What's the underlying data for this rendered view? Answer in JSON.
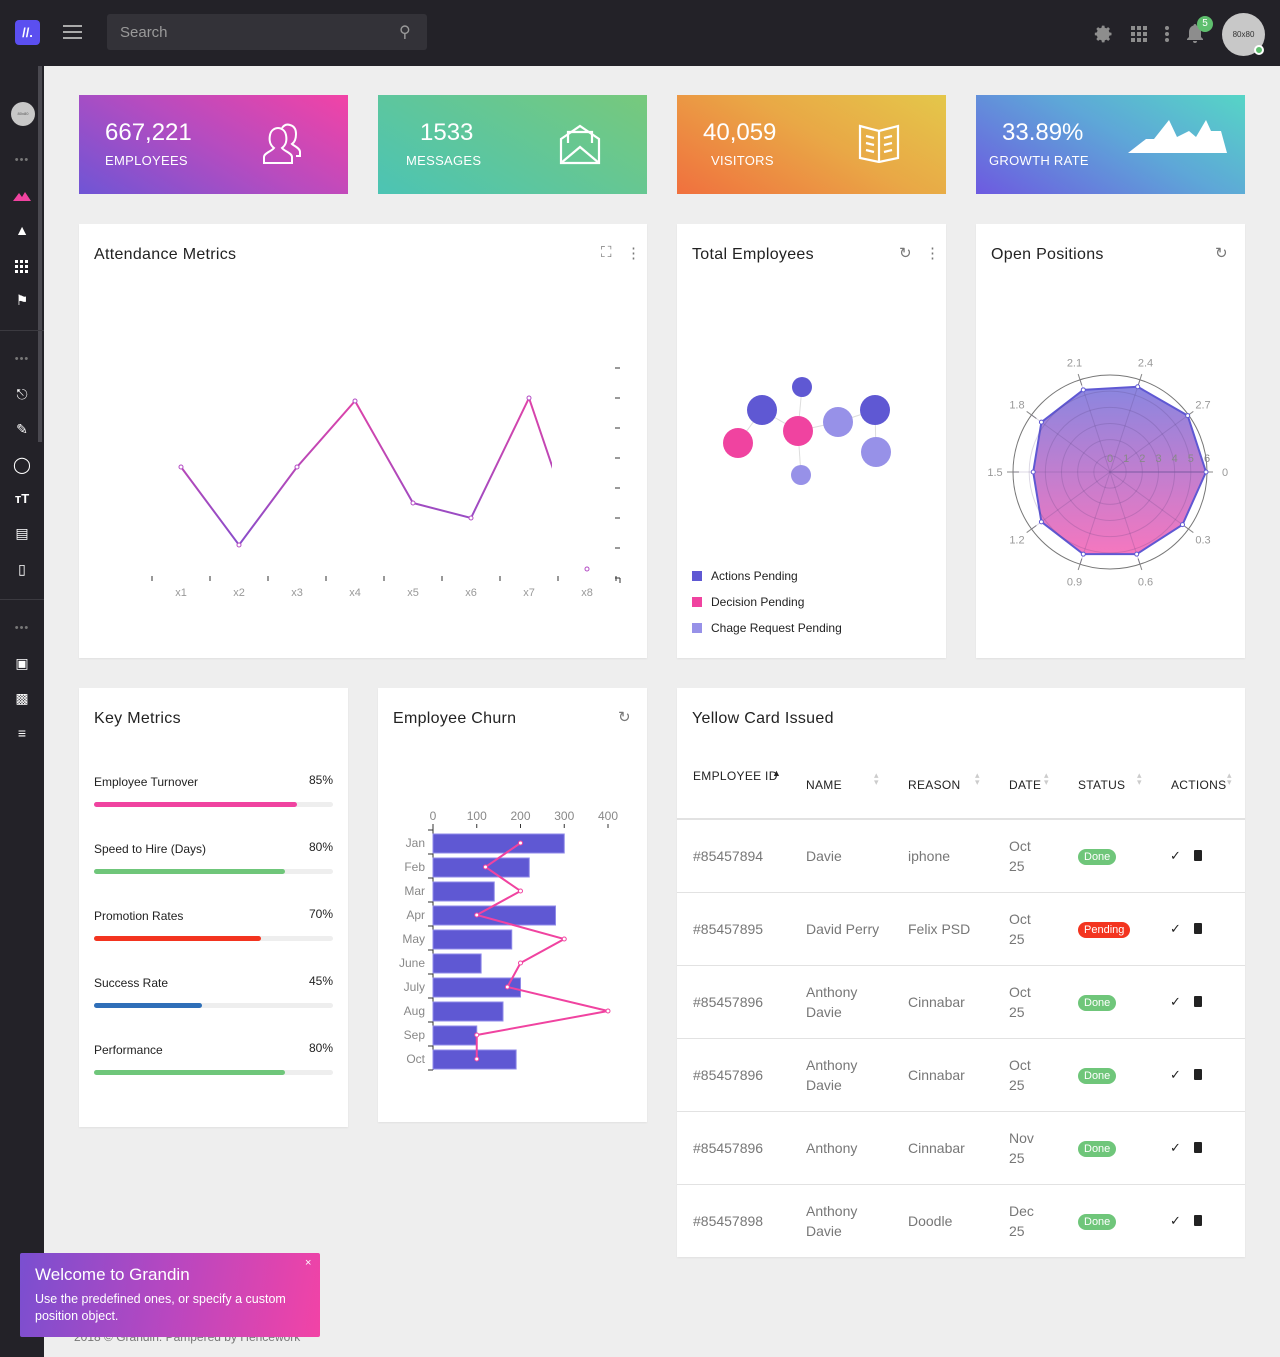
{
  "header": {
    "logo_glyph": "//.",
    "search_placeholder": "Search",
    "notification_count": "5",
    "avatar_text": "80x80",
    "icons": [
      "menu-icon",
      "search-icon",
      "gear-icon",
      "apps-grid-icon",
      "more-vertical-icon",
      "bell-icon"
    ]
  },
  "sidebar": {
    "avatar_text": "80x80",
    "dots": "•••",
    "icons": [
      "mountain-icon",
      "basket-icon",
      "grid-icon",
      "flag-icon",
      "login-icon",
      "pencil-icon",
      "circle-icon",
      "text-size-icon",
      "divider-icon",
      "map-icon",
      "fullscreen-icon",
      "book-icon",
      "filter-icon"
    ],
    "active_color": "#f043a0"
  },
  "stats": [
    {
      "value": "667,221",
      "label": "EMPLOYEES",
      "icon": "users-icon"
    },
    {
      "value": "1533",
      "label": "MESSAGES",
      "icon": "envelope-open-icon"
    },
    {
      "value": "40,059",
      "label": "VISITORS",
      "icon": "book-open-icon"
    },
    {
      "value": "33.89%",
      "label": "GROWTH RATE",
      "icon": "mountains-icon"
    }
  ],
  "attendance": {
    "title": "Attendance Metrics"
  },
  "total_employees": {
    "title": "Total Employees",
    "legend": [
      {
        "label": "Actions Pending",
        "color": "#5f58d3"
      },
      {
        "label": "Decision Pending",
        "color": "#f043a0"
      },
      {
        "label": "Chage Request Pending",
        "color": "#9791e8"
      }
    ]
  },
  "open_positions": {
    "title": "Open Positions"
  },
  "key_metrics": {
    "title": "Key Metrics",
    "items": [
      {
        "label": "Employee Turnover",
        "value": "85%",
        "percent": 85,
        "color": "#f043a0"
      },
      {
        "label": "Speed to Hire (Days)",
        "value": "80%",
        "percent": 80,
        "color": "#6fc67a"
      },
      {
        "label": "Promotion Rates",
        "value": "70%",
        "percent": 70,
        "color": "#f3341f"
      },
      {
        "label": "Success Rate",
        "value": "45%",
        "percent": 45,
        "color": "#2f6fb8"
      },
      {
        "label": "Performance",
        "value": "80%",
        "percent": 80,
        "color": "#6fc67a"
      }
    ]
  },
  "churn": {
    "title": "Employee Churn"
  },
  "yellow_card": {
    "title": "Yellow Card Issued",
    "columns": [
      "EMPLOYEE ID",
      "NAME",
      "REASON",
      "DATE",
      "STATUS",
      "ACTIONS"
    ],
    "rows": [
      {
        "id": "#85457894",
        "name": "Davie",
        "reason": "iphone",
        "date": "Oct 25",
        "status": "Done"
      },
      {
        "id": "#85457895",
        "name": "David Perry",
        "reason": "Felix PSD",
        "date": "Oct 25",
        "status": "Pending"
      },
      {
        "id": "#85457896",
        "name": "Anthony Davie",
        "reason": "Cinnabar",
        "date": "Oct 25",
        "status": "Done"
      },
      {
        "id": "#85457896",
        "name": "Anthony Davie",
        "reason": "Cinnabar",
        "date": "Oct 25",
        "status": "Done"
      },
      {
        "id": "#85457896",
        "name": "Anthony",
        "reason": "Cinnabar",
        "date": "Nov 25",
        "status": "Done"
      },
      {
        "id": "#85457898",
        "name": "Anthony Davie",
        "reason": "Doodle",
        "date": "Dec 25",
        "status": "Done"
      }
    ],
    "status_colors": {
      "Done": "#6fc67a",
      "Pending": "#f3341f"
    }
  },
  "toast": {
    "title": "Welcome to Grandin",
    "message": "Use the predefined ones, or specify a custom position object.",
    "close": "×"
  },
  "footer": {
    "text": "2018 © Grandin. Pampered by Hencework"
  },
  "chart_data": [
    {
      "type": "line",
      "x": [
        "x1",
        "x2",
        "x3",
        "x4",
        "x5",
        "x6",
        "x7",
        "x8"
      ],
      "values": [
        3.7,
        1.1,
        3.7,
        5.9,
        2.5,
        2.0,
        6.0,
        0.3
      ],
      "ylim": [
        0,
        7
      ],
      "colors": [
        "#7a4fd0",
        "#e043a8"
      ]
    },
    {
      "type": "bubble-network",
      "nodes": [
        {
          "group": "Actions Pending",
          "size": "small"
        },
        {
          "group": "Actions Pending",
          "size": "large"
        },
        {
          "group": "Decision Pending",
          "size": "large"
        },
        {
          "group": "Decision Pending",
          "size": "large"
        },
        {
          "group": "Chage Request Pending",
          "size": "large"
        },
        {
          "group": "Actions Pending",
          "size": "large"
        },
        {
          "group": "Chage Request Pending",
          "size": "large"
        },
        {
          "group": "Chage Request Pending",
          "size": "small"
        }
      ]
    },
    {
      "type": "radar",
      "angle_ticks": [
        "0",
        "0.3",
        "0.6",
        "0.9",
        "1.2",
        "1.5",
        "1.8",
        "2.1",
        "2.4",
        "2.7"
      ],
      "radial_ticks": [
        "0",
        "1",
        "2",
        "3",
        "4",
        "5",
        "6"
      ],
      "rlim": [
        0,
        6
      ],
      "values": [
        6.0,
        5.6,
        5.4,
        5.4,
        5.3,
        4.8,
        5.3,
        5.4,
        5.6,
        6.0
      ]
    },
    {
      "type": "bar",
      "orientation": "horizontal",
      "categories": [
        "Jan",
        "Feb",
        "Mar",
        "Apr",
        "May",
        "June",
        "July",
        "Aug",
        "Sep",
        "Oct"
      ],
      "xticks": [
        "0",
        "100",
        "200",
        "300",
        "400"
      ],
      "xlim": [
        0,
        400
      ],
      "series": [
        {
          "type": "bar",
          "values": [
            300,
            220,
            140,
            280,
            180,
            110,
            200,
            160,
            100,
            190
          ],
          "color": "#5f58d3"
        },
        {
          "type": "line",
          "values": [
            200,
            120,
            200,
            100,
            300,
            200,
            170,
            400,
            100,
            100
          ],
          "color": "#f043a0"
        }
      ]
    }
  ]
}
